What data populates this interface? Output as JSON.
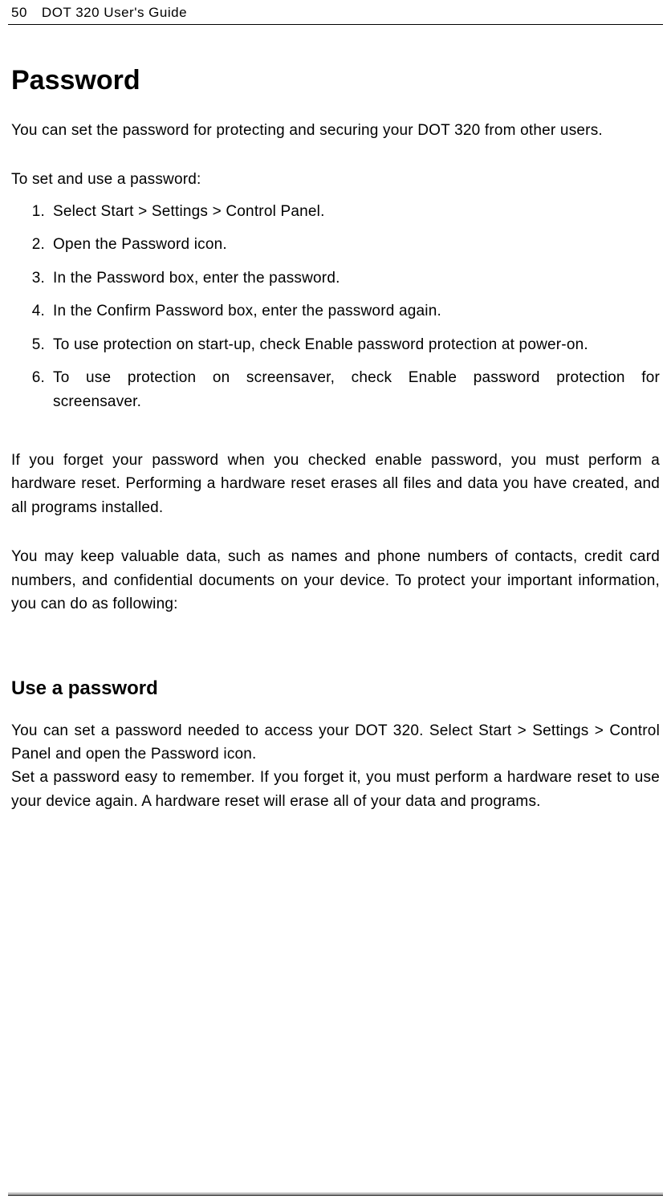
{
  "header": {
    "page_number": "50",
    "title": "DOT 320 User's Guide"
  },
  "section1": {
    "heading": "Password",
    "intro": "You can set the password for protecting and securing your DOT 320 from other users.",
    "steps_intro": "To set and use a password:",
    "steps": [
      {
        "num": "1.",
        "text": "Select Start > Settings > Control Panel."
      },
      {
        "num": "2.",
        "text": "Open the Password icon."
      },
      {
        "num": "3.",
        "text": "In the Password box, enter the password."
      },
      {
        "num": "4.",
        "text": "In the Confirm Password box, enter the password again."
      },
      {
        "num": "5.",
        "text": "To use protection on start-up, check Enable password protection at power-on."
      },
      {
        "num": "6.",
        "text_line1": "To use protection on screensaver, check Enable password protection for",
        "text_line2": "screensaver."
      }
    ],
    "para2": "If you forget your password when you checked enable password, you must perform a hardware reset. Performing a hardware reset erases all files and data you have created, and all programs installed.",
    "para3": "You may keep valuable data, such as names and phone numbers of contacts, credit card numbers, and confidential documents on your device. To protect your important information, you can do as following:"
  },
  "section2": {
    "heading": "Use a password",
    "para1": "You can set a password needed to access your DOT 320. Select Start > Settings > Control Panel and open the Password icon.",
    "para2": "Set a password easy to remember. If you forget it, you must perform a hardware reset to use your device again. A hardware reset will erase all of your data and programs."
  }
}
